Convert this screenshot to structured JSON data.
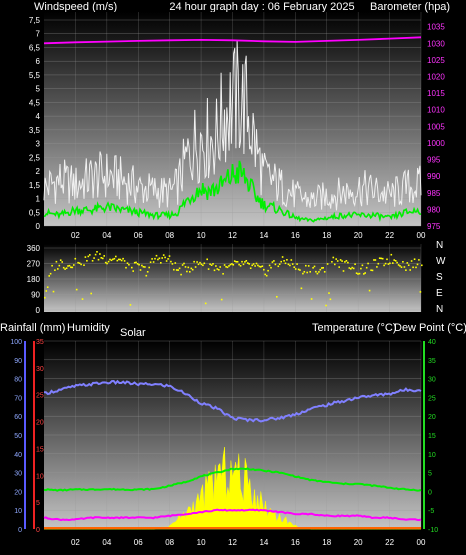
{
  "header": {
    "left_label": "Windspeed (m/s)",
    "center_label": "24 hour graph day : 06 February 2025",
    "right_label": "Barometer (hpa)"
  },
  "x_ticks": [
    "02",
    "04",
    "06",
    "08",
    "10",
    "12",
    "14",
    "16",
    "18",
    "20",
    "22",
    "00"
  ],
  "wind_panel": {
    "left_ticks": [
      "7,5",
      "7",
      "6,5",
      "6",
      "5,5",
      "5",
      "4,5",
      "4",
      "3,5",
      "3",
      "2,5",
      "2",
      "1,5",
      "1",
      "0,5",
      "0"
    ],
    "right_ticks": [
      "1035",
      "1030",
      "1025",
      "1020",
      "1015",
      "1010",
      "1005",
      "1000",
      "995",
      "990",
      "985",
      "980",
      "975"
    ]
  },
  "direction_panel": {
    "left_ticks": [
      "360",
      "270",
      "180",
      "90",
      "0"
    ],
    "right_labels": [
      "N",
      "W",
      "S",
      "E",
      "N"
    ]
  },
  "temp_panel": {
    "rain_label": "Rainfall (mm)",
    "humidity_label": "Humidity",
    "solar_label": "Solar",
    "temp_label": "Temperature (°C)",
    "dew_label": "Dew Point (°C)",
    "humidity_ticks": [
      "100",
      "90",
      "80",
      "70",
      "60",
      "50",
      "40",
      "30",
      "20",
      "10",
      "0"
    ],
    "rain_ticks": [
      "35",
      "30",
      "25",
      "20",
      "15",
      "10",
      "5",
      "0"
    ],
    "temp_ticks": [
      "40",
      "35",
      "30",
      "25",
      "20",
      "15",
      "10",
      "5",
      "0",
      "-5",
      "-10"
    ]
  },
  "colors": {
    "gust": "#f0f0f0",
    "wind_avg": "#00ee00",
    "barometer": "#ff00ff",
    "direction": "#ffff00",
    "humidity": "#8080ff",
    "temperature": "#00ee00",
    "dewpoint": "#ff00ff",
    "solar": "#ffff00",
    "rain": "#ff3333"
  },
  "chart_data": [
    {
      "type": "line",
      "title": "24 hour graph day : 06 February 2025",
      "xlabel": "",
      "ylabel": "Windspeed (m/s)",
      "x": [
        0,
        1,
        2,
        3,
        4,
        5,
        6,
        7,
        8,
        8.5,
        9,
        9.5,
        10,
        10.5,
        11,
        11.5,
        12,
        12.5,
        13,
        13.5,
        14,
        15,
        16,
        17,
        18,
        19,
        20,
        21,
        22,
        23,
        24
      ],
      "ylim": [
        0,
        7.5
      ],
      "series": [
        {
          "name": "Wind gust",
          "values": [
            1.5,
            1.8,
            1.6,
            1.9,
            2.0,
            1.8,
            1.5,
            1.4,
            1.3,
            1.6,
            2.5,
            3.2,
            3.5,
            3.4,
            3.5,
            4.5,
            4.8,
            5.0,
            4.5,
            3.0,
            2.0,
            1.6,
            1.2,
            1.0,
            1.2,
            1.3,
            1.5,
            1.4,
            1.2,
            1.5,
            1.6
          ]
        },
        {
          "name": "Wind average",
          "values": [
            0.5,
            0.4,
            0.6,
            0.6,
            0.7,
            0.6,
            0.5,
            0.4,
            0.4,
            0.5,
            0.9,
            1.2,
            1.4,
            1.3,
            1.4,
            1.6,
            1.9,
            2.0,
            1.6,
            1.1,
            0.8,
            0.6,
            0.3,
            0.2,
            0.3,
            0.4,
            0.4,
            0.4,
            0.3,
            0.5,
            0.6
          ]
        }
      ],
      "y2label": "Barometer (hpa)",
      "y2lim": [
        975,
        1037
      ],
      "y2_series": {
        "name": "Barometer",
        "x": [
          0,
          2,
          4,
          6,
          8,
          10,
          12,
          14,
          16,
          18,
          20,
          22,
          24
        ],
        "values": [
          1030.0,
          1030.3,
          1030.5,
          1030.7,
          1030.9,
          1031.0,
          1030.9,
          1030.6,
          1030.4,
          1030.7,
          1031.0,
          1031.4,
          1031.8
        ]
      }
    },
    {
      "type": "scatter",
      "ylabel": "",
      "ylim": [
        0,
        360
      ],
      "series": [
        {
          "name": "Wind direction",
          "x": [
            0,
            0.5,
            1,
            1.5,
            2,
            2.5,
            3,
            3.5,
            4,
            4.5,
            5,
            5.5,
            6,
            6.5,
            7,
            7.5,
            8,
            8.5,
            9,
            9.5,
            10,
            10.5,
            11,
            11.5,
            12,
            12.5,
            13,
            13.5,
            14,
            14.5,
            15,
            15.5,
            16,
            16.5,
            17,
            17.5,
            18,
            18.5,
            19,
            19.5,
            20,
            20.5,
            21,
            21.5,
            22,
            22.5,
            23,
            23.5,
            24
          ],
          "values": [
            90,
            250,
            280,
            260,
            300,
            290,
            310,
            320,
            300,
            310,
            280,
            260,
            250,
            230,
            300,
            310,
            290,
            230,
            250,
            260,
            280,
            270,
            250,
            240,
            260,
            270,
            260,
            250,
            220,
            270,
            280,
            290,
            250,
            240,
            260,
            210,
            280,
            300,
            260,
            270,
            230,
            240,
            270,
            280,
            300,
            290,
            260,
            270,
            280
          ]
        }
      ]
    },
    {
      "type": "line",
      "xlabel": "",
      "ylabel": "Humidity",
      "ylim": [
        0,
        100
      ],
      "x": [
        0,
        1,
        2,
        3,
        4,
        5,
        6,
        7,
        8,
        9,
        10,
        11,
        12,
        13,
        14,
        15,
        16,
        17,
        18,
        19,
        20,
        21,
        22,
        23,
        24
      ],
      "series": [
        {
          "name": "Humidity",
          "values": [
            72,
            74,
            76,
            77,
            78,
            78,
            77,
            77,
            76,
            72,
            67,
            64,
            59,
            58,
            58,
            59,
            61,
            64,
            66,
            68,
            70,
            71,
            72,
            74,
            74
          ]
        },
        {
          "name": "Temperature",
          "axis": "right",
          "values": [
            0.5,
            0.3,
            0.5,
            0.5,
            0.6,
            0.5,
            0.5,
            0.6,
            1.5,
            2.5,
            4.0,
            5.0,
            6.0,
            6.0,
            5.5,
            5.0,
            4.0,
            3.0,
            2.5,
            2.0,
            2.0,
            1.5,
            1.0,
            0.5,
            0.3
          ]
        },
        {
          "name": "Dew Point",
          "axis": "right",
          "values": [
            -7,
            -7.5,
            -7.5,
            -7,
            -7,
            -7,
            -7,
            -7,
            -6.5,
            -6,
            -5.5,
            -5,
            -5,
            -5,
            -5,
            -5.5,
            -6,
            -6,
            -6.5,
            -6.5,
            -6.5,
            -7,
            -7,
            -7.5,
            -7.5
          ]
        },
        {
          "name": "Solar",
          "axis": "humidity",
          "values": [
            0,
            0,
            0,
            0,
            0,
            0,
            0,
            0,
            2,
            10,
            20,
            35,
            38,
            30,
            15,
            8,
            2,
            0,
            0,
            0,
            0,
            0,
            0,
            0,
            0
          ]
        },
        {
          "name": "Rainfall",
          "axis": "rain",
          "values": [
            0,
            0,
            0,
            0,
            0,
            0,
            0,
            0,
            0,
            0,
            0,
            0,
            0,
            0,
            0,
            0,
            0,
            0,
            0,
            0,
            0,
            0,
            0,
            0,
            0
          ]
        }
      ],
      "y_rain_lim": [
        0,
        35
      ],
      "y_temp_lim": [
        -10,
        40
      ]
    }
  ]
}
